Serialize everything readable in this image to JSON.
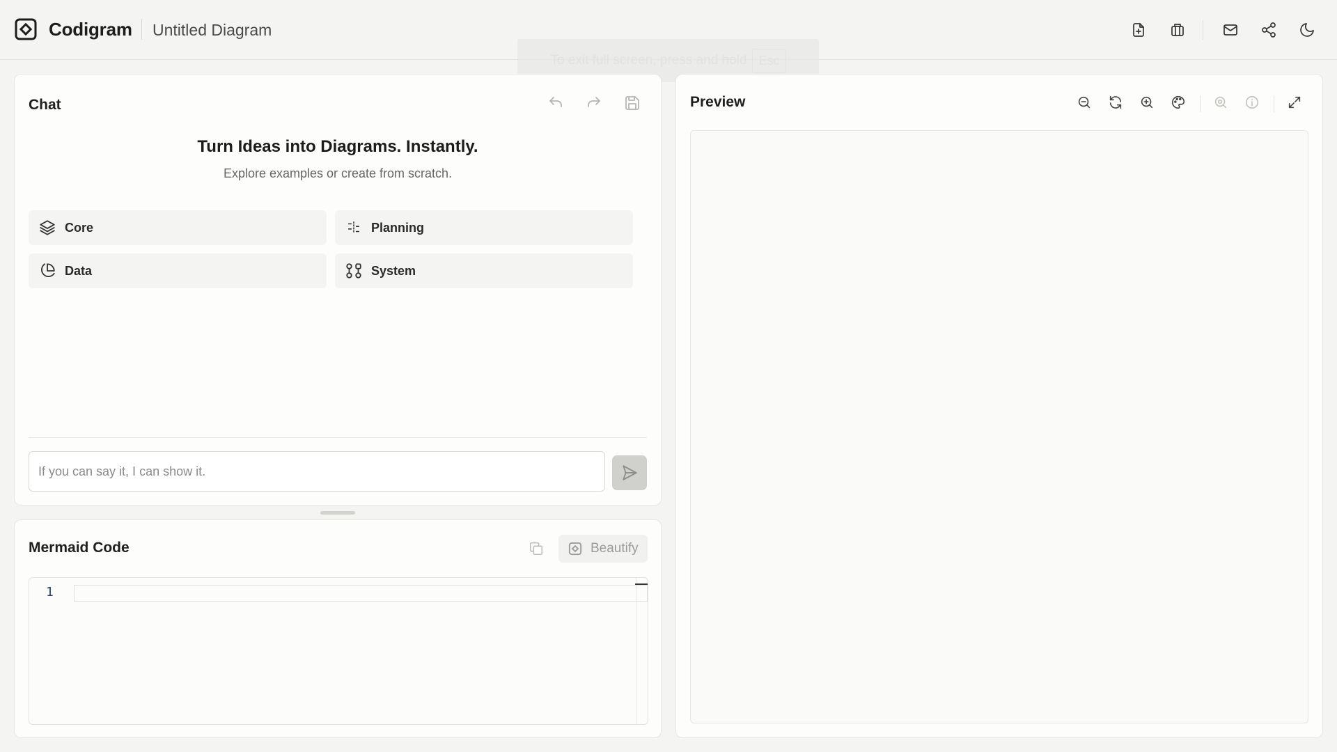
{
  "header": {
    "app_name": "Codigram",
    "doc_title": "Untitled Diagram",
    "icons": [
      "new-file-icon",
      "templates-icon",
      "mail-icon",
      "share-icon",
      "moon-icon"
    ]
  },
  "toast": {
    "text": "To exit full screen, press and hold",
    "key": "Esc"
  },
  "chat": {
    "title": "Chat",
    "hero_title": "Turn Ideas into Diagrams. Instantly.",
    "hero_subtitle": "Explore examples or create from scratch.",
    "categories": [
      {
        "label": "Core",
        "icon": "layers-icon"
      },
      {
        "label": "Planning",
        "icon": "timeline-icon"
      },
      {
        "label": "Data",
        "icon": "pie-chart-icon"
      },
      {
        "label": "System",
        "icon": "nodes-icon"
      }
    ],
    "input_placeholder": "If you can say it, I can show it.",
    "input_value": ""
  },
  "code": {
    "title": "Mermaid Code",
    "beautify_label": "Beautify",
    "line_numbers": [
      "1"
    ]
  },
  "preview": {
    "title": "Preview"
  },
  "colors": {
    "background": "#f4f4f2",
    "panel": "#fdfdfc",
    "border": "#e6e6e3",
    "muted_icon": "#b5b5b2",
    "text": "#1c1c1c"
  }
}
